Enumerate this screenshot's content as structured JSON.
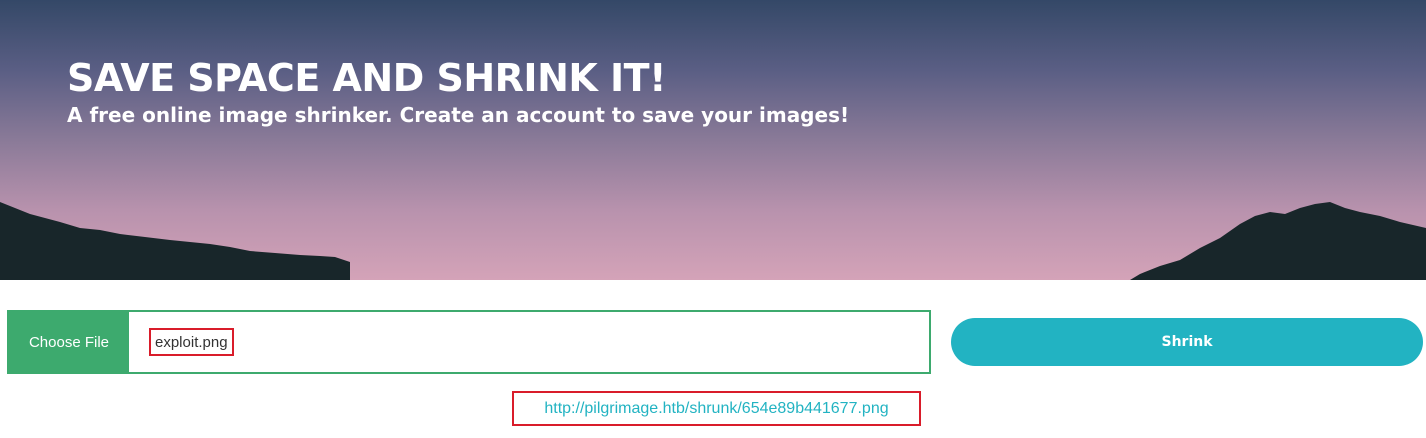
{
  "hero": {
    "title": "SAVE SPACE AND SHRINK IT!",
    "subtitle": "A free online image shrinker. Create an account to save your images!"
  },
  "upload": {
    "choose_label": "Choose File",
    "filename": "exploit.png"
  },
  "actions": {
    "shrink_label": "Shrink"
  },
  "result": {
    "link": "http://pilgrimage.htb/shrunk/654e89b441677.png"
  },
  "colors": {
    "choose_bg": "#3daa6e",
    "shrink_bg": "#22b3c2",
    "link": "#22b3c2",
    "highlight": "#d91c2a",
    "mountains": "#18262a"
  },
  "icons": [
    "mountain-silhouette"
  ]
}
